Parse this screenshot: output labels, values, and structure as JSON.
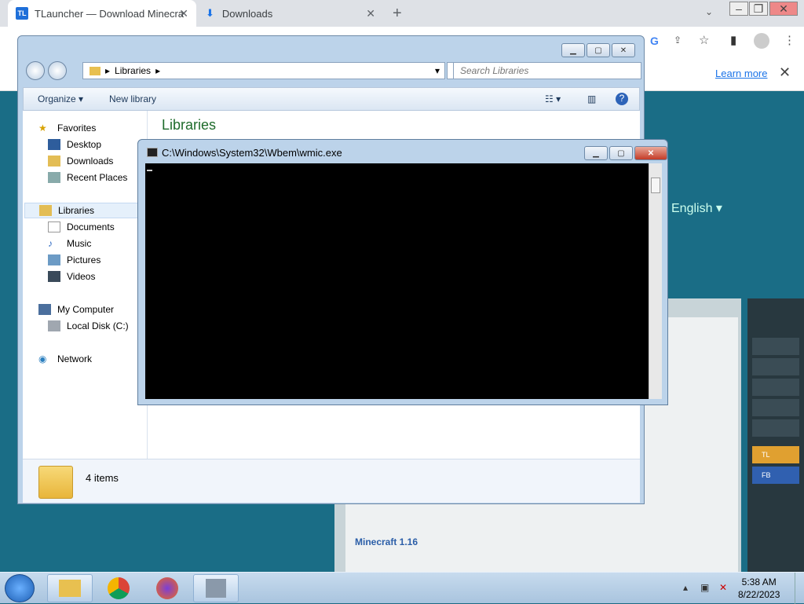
{
  "browser": {
    "tabs": [
      {
        "label": "TLauncher — Download Minecra",
        "favicon": "TL"
      },
      {
        "label": "Downloads"
      }
    ],
    "infobar": {
      "learn_more": "Learn more"
    }
  },
  "site": {
    "language": "English",
    "heading": "Minecraft 1.16",
    "sidebar_labels": [
      "TL",
      "FB"
    ]
  },
  "explorer": {
    "address": "Libraries",
    "search_placeholder": "Search Libraries",
    "toolbar": {
      "organize": "Organize",
      "new_library": "New library"
    },
    "nav": {
      "favorites": "Favorites",
      "desktop": "Desktop",
      "downloads": "Downloads",
      "recent_places": "Recent Places",
      "libraries": "Libraries",
      "documents": "Documents",
      "music": "Music",
      "pictures": "Pictures",
      "videos": "Videos",
      "my_computer": "My Computer",
      "local_disk": "Local Disk (C:)",
      "network": "Network"
    },
    "content_title": "Libraries",
    "status_count": "4 items"
  },
  "cmd": {
    "title": "C:\\Windows\\System32\\Wbem\\wmic.exe"
  },
  "taskbar": {
    "time": "5:38 AM",
    "date": "8/22/2023"
  },
  "colors": {
    "accent": "#1a73e8",
    "console_bg": "#000000",
    "library_title": "#1e6b2b"
  }
}
